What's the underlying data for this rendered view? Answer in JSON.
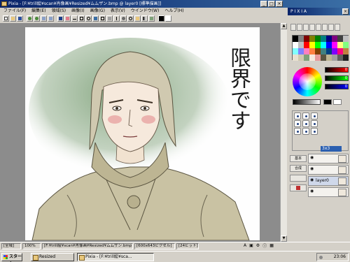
{
  "window": {
    "title": "Pixia - [F:¥trill絵¥scan¥肖像画¥Resized¥ムムザン.bmp @ layer0 [標準描画]]"
  },
  "menu": {
    "items": [
      "ファイル(F)",
      "編集(E)",
      "領域(S)",
      "画像(I)",
      "画像(G)",
      "表示(V)",
      "ウインドウ(W)",
      "ヘルプ(H)"
    ]
  },
  "panel": {
    "title": "P I X I A"
  },
  "canvas": {
    "vertical_text": "限界です"
  },
  "brush": {
    "size_label": "3x3"
  },
  "layers": {
    "side_buttons": [
      "基本",
      "合成",
      "",
      ""
    ],
    "rows": [
      "",
      "",
      "layer0",
      ""
    ]
  },
  "status": {
    "mode": "[全域]",
    "zoom": "100%",
    "path": "[F:¥trill絵¥scan¥肖像画¥Resized¥ムムザン.bmp]",
    "size": "[600x643ピクセル]",
    "depth": "[24ビット]"
  },
  "taskbar": {
    "start_label": "スタート",
    "tasks": [
      "Resized",
      "Pixia - [F:¥trill絵¥sca..."
    ],
    "clock": "23:06"
  },
  "colors": {
    "title_start": "#0a246a",
    "title_end": "#3a6ea5",
    "face_chrome": "#d4d0c8",
    "canvas_bg": "#8c8c8c",
    "wash_green": "#7fa27a"
  },
  "icons": [
    "app-icon",
    "minimize-icon",
    "maximize-icon",
    "close-icon",
    "pen-icon",
    "eraser-icon",
    "fill-icon",
    "select-icon",
    "eye-icon",
    "windows-logo-icon"
  ]
}
